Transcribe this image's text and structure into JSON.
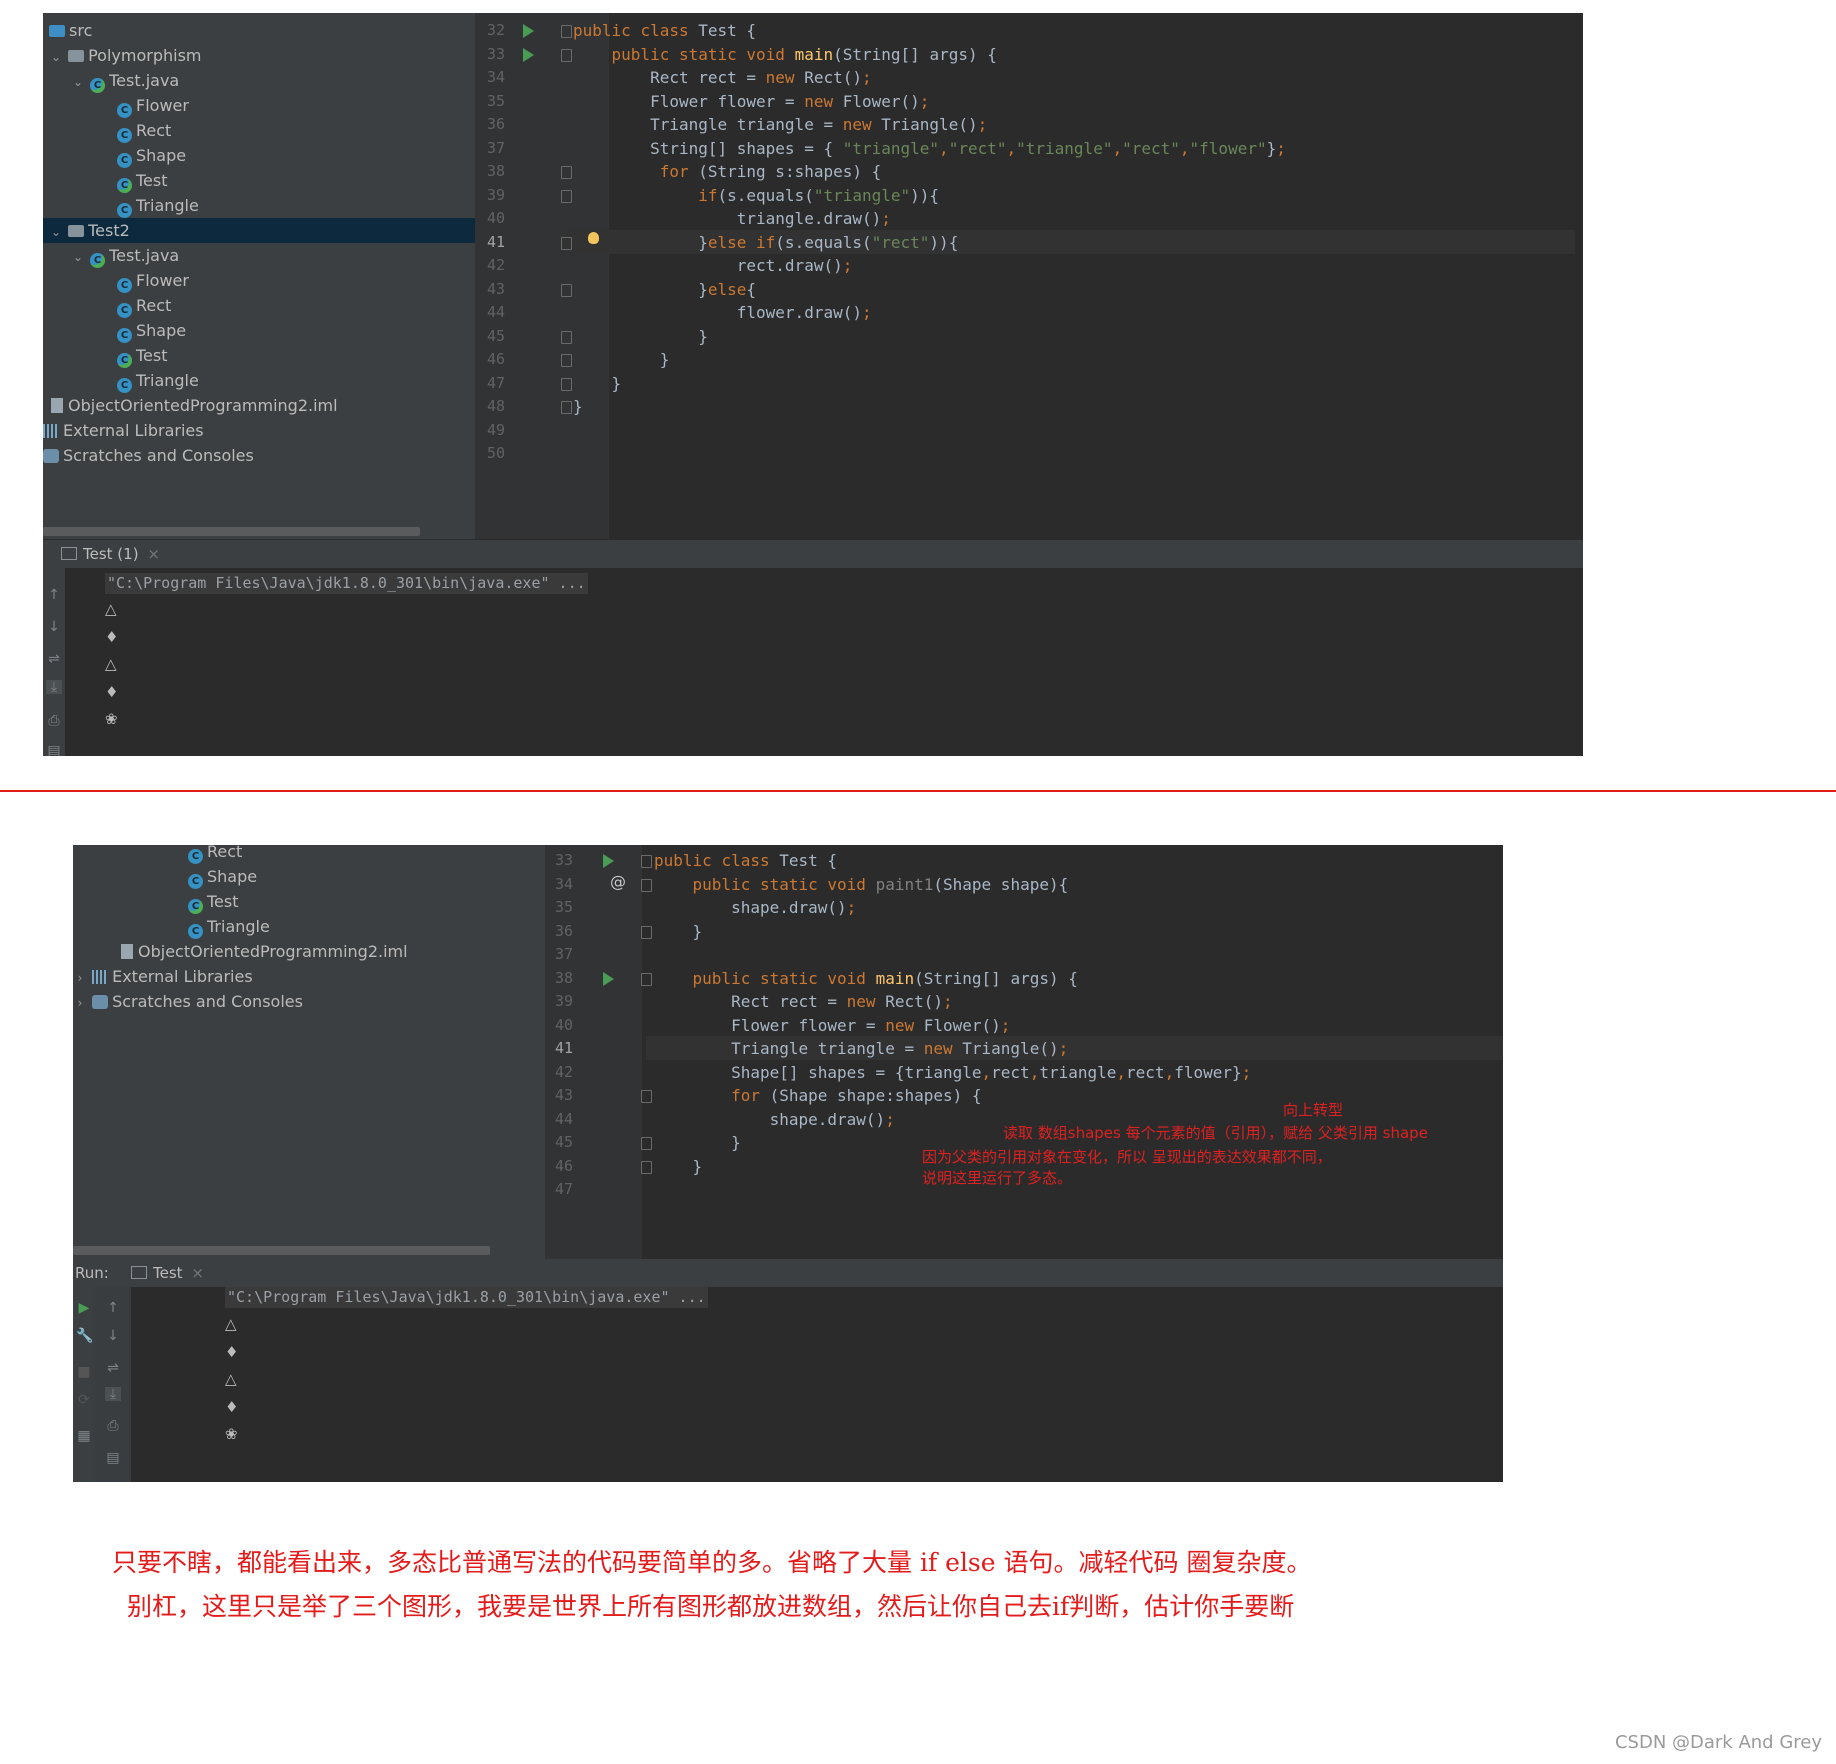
{
  "top": {
    "tree": [
      {
        "label": "src",
        "icon": "folder-icon"
      },
      {
        "label": "Polymorphism",
        "icon": "package-icon"
      },
      {
        "label": "Test.java",
        "icon": "java-file-icon"
      },
      {
        "label": "Flower",
        "icon": "class-icon"
      },
      {
        "label": "Rect",
        "icon": "class-icon"
      },
      {
        "label": "Shape",
        "icon": "class-icon"
      },
      {
        "label": "Test",
        "icon": "runnable-class-icon"
      },
      {
        "label": "Triangle",
        "icon": "class-icon"
      },
      {
        "label": "Test2",
        "icon": "package-icon"
      },
      {
        "label": "Test.java",
        "icon": "java-file-icon"
      },
      {
        "label": "Flower",
        "icon": "class-icon"
      },
      {
        "label": "Rect",
        "icon": "class-icon"
      },
      {
        "label": "Shape",
        "icon": "class-icon"
      },
      {
        "label": "Test",
        "icon": "runnable-class-icon"
      },
      {
        "label": "Triangle",
        "icon": "class-icon"
      },
      {
        "label": "ObjectOrientedProgramming2.iml",
        "icon": "iml-file-icon"
      },
      {
        "label": "External Libraries",
        "icon": "library-icon"
      },
      {
        "label": "Scratches and Consoles",
        "icon": "scratches-icon"
      }
    ],
    "line_numbers": [
      "32",
      "33",
      "34",
      "35",
      "36",
      "37",
      "38",
      "39",
      "40",
      "41",
      "42",
      "43",
      "44",
      "45",
      "46",
      "47",
      "48",
      "49",
      "50"
    ],
    "current_line": "41",
    "code": [
      "public class Test {",
      "    public static void main(String[] args) {",
      "        Rect rect = new Rect();",
      "        Flower flower = new Flower();",
      "        Triangle triangle = new Triangle();",
      "        String[] shapes = { \"triangle\",\"rect\",\"triangle\",\"rect\",\"flower\"};",
      "         for (String s:shapes) {",
      "             if(s.equals(\"triangle\")){",
      "                 triangle.draw();",
      "             }else if(s.equals(\"rect\")){",
      "                 rect.draw();",
      "             }else{",
      "                 flower.draw();",
      "             }",
      "         }",
      "    }",
      "}",
      "",
      ""
    ],
    "run_tab": "Test (1)",
    "tab_close": "×",
    "command": "\"C:\\Program Files\\Java\\jdk1.8.0_301\\bin\\java.exe\" ...",
    "output": [
      "△",
      "♦",
      "△",
      "♦",
      "❀"
    ]
  },
  "bottom": {
    "tree": [
      {
        "label": "Rect",
        "icon": "class-icon"
      },
      {
        "label": "Shape",
        "icon": "class-icon"
      },
      {
        "label": "Test",
        "icon": "runnable-class-icon"
      },
      {
        "label": "Triangle",
        "icon": "class-icon"
      },
      {
        "label": "ObjectOrientedProgramming2.iml",
        "icon": "iml-file-icon"
      },
      {
        "label": "External Libraries",
        "icon": "library-icon"
      },
      {
        "label": "Scratches and Consoles",
        "icon": "scratches-icon"
      }
    ],
    "line_numbers": [
      "33",
      "34",
      "35",
      "36",
      "37",
      "38",
      "39",
      "40",
      "41",
      "42",
      "43",
      "44",
      "45",
      "46",
      "47"
    ],
    "current_line": "41",
    "code": [
      "public class Test {",
      "    public static void paint1(Shape shape){",
      "        shape.draw();",
      "    }",
      "",
      "    public static void main(String[] args) {",
      "        Rect rect = new Rect();",
      "        Flower flower = new Flower();",
      "        Triangle triangle = new Triangle();",
      "        Shape[] shapes = {triangle,rect,triangle,rect,flower};",
      "        for (Shape shape:shapes) {",
      "            shape.draw();",
      "        }",
      "    }",
      ""
    ],
    "annotations": {
      "upcast": "向上转型",
      "read": "读取 数组shapes 每个元素的值（引用），赋给 父类引用 shape",
      "explain1": "因为父类的引用对象在变化，所以 呈现出的表达效果都不同，",
      "explain2": "说明这里运行了多态。"
    },
    "run_label": "Run:",
    "run_tab": "Test",
    "tab_close": "×",
    "command": "\"C:\\Program Files\\Java\\jdk1.8.0_301\\bin\\java.exe\" ...",
    "output": [
      "△",
      "♦",
      "△",
      "♦",
      "❀"
    ],
    "override_marker": "@"
  },
  "notes": {
    "line1": "只要不瞎，都能看出来，多态比普通写法的代码要简单的多。省略了大量 if else 语句。减轻代码 圈复杂度。",
    "line2": "别杠，这里只是举了三个图形，我要是世界上所有图形都放进数组，然后让你自己去if判断，估计你手要断"
  },
  "watermark": "CSDN @Dark And Grey",
  "colors": {
    "ide_bg": "#2b2b2b",
    "panel_bg": "#3c3f41",
    "keyword": "#cc7832",
    "string": "#6a8759",
    "method": "#ffc66d",
    "text": "#a9b7c6",
    "annotation_red": "#e02020",
    "divider_red": "#e41b1b"
  }
}
